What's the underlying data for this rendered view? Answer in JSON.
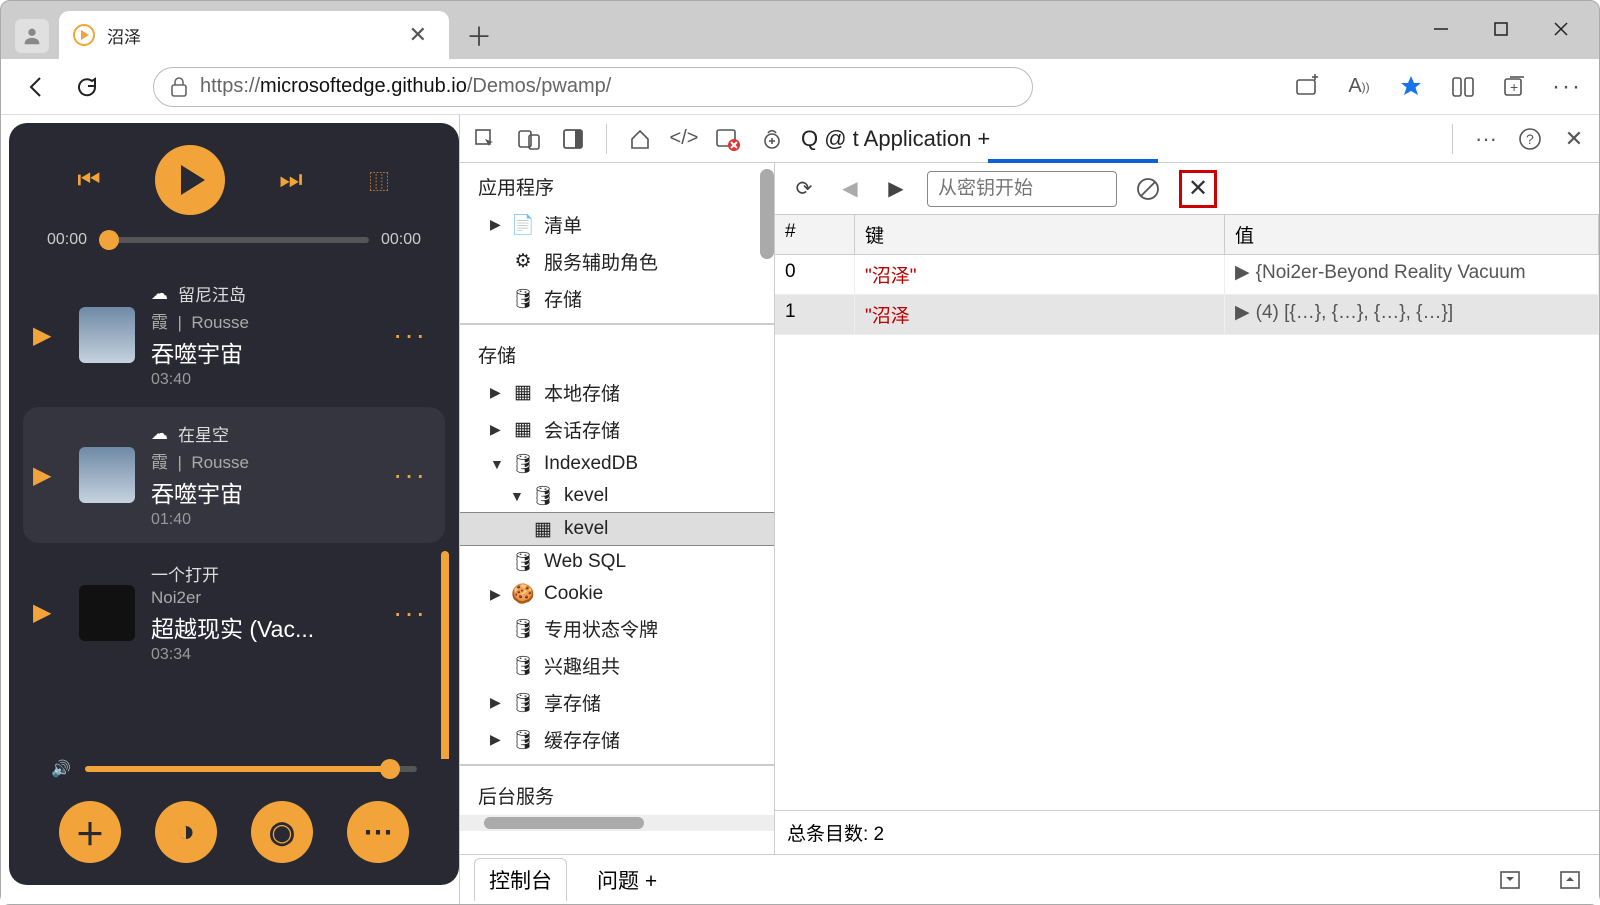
{
  "browser": {
    "tab_title": "沼泽",
    "url_prefix": "https://",
    "url_domain": "microsoftedge.github.io",
    "url_path": "/Demos/pwamp/"
  },
  "player": {
    "time_current": "00:00",
    "time_total": "00:00",
    "songs": [
      {
        "tag": "留尼汪岛",
        "artist1": "霞",
        "artist2": "Rousse",
        "title": "吞噬宇宙",
        "duration": "03:40"
      },
      {
        "tag": "在星空",
        "artist1": "霞",
        "artist2": "Rousse",
        "title": "吞噬宇宙",
        "duration": "01:40"
      },
      {
        "tag": "一个打开",
        "artist1": "Noi2er",
        "artist2": "",
        "title": "超越现实 (Vac...",
        "duration": "03:34"
      }
    ]
  },
  "devtools": {
    "tab_text": "Q @ t Application +",
    "filter_placeholder": "从密钥开始",
    "tree": {
      "section_app": "应用程序",
      "manifest": "清单",
      "service_workers": "服务辅助角色",
      "storage_overview": "存储",
      "section_storage": "存储",
      "local_storage": "本地存储",
      "session_storage": "会话存储",
      "indexeddb": "IndexedDB",
      "idb_db": "kevel",
      "idb_store": "kevel",
      "websql": "Web SQL",
      "cookie": "Cookie",
      "private_state": "专用状态令牌",
      "interest_group": "兴趣组共",
      "shared_storage": "享存储",
      "cache_storage": "缓存存储",
      "section_bg": "后台服务"
    },
    "table": {
      "hdr_index": "#",
      "hdr_key": "键",
      "hdr_value": "值",
      "rows": [
        {
          "idx": "0",
          "key": "\"沼泽\"",
          "val": "{Noi2er-Beyond        Reality Vacuum"
        },
        {
          "idx": "1",
          "key": "\"沼泽",
          "val": "(4) [{…}, {…}, {…}, {…}]"
        }
      ],
      "footer": "总条目数: 2"
    },
    "drawer": {
      "console": "控制台",
      "issues": "问题 +"
    }
  }
}
